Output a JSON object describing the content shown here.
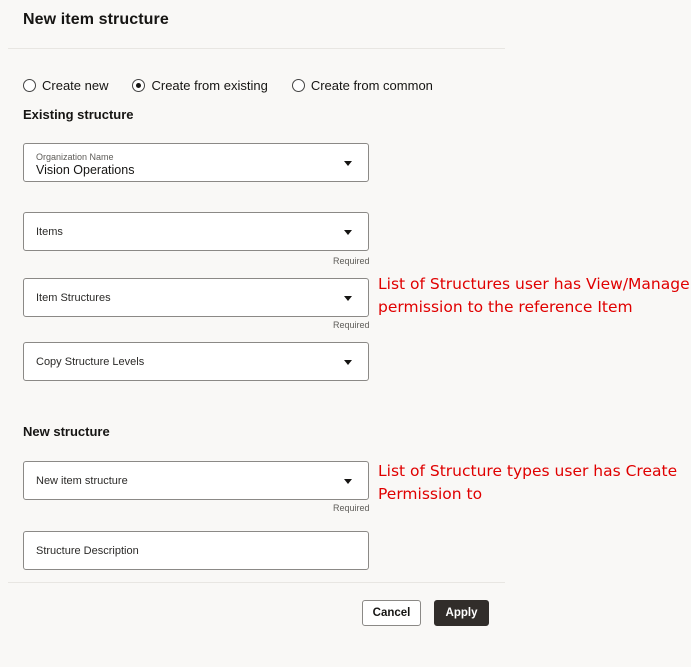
{
  "dialog": {
    "title": "New item structure"
  },
  "mode_options": [
    {
      "label": "Create new",
      "selected": false
    },
    {
      "label": "Create from existing",
      "selected": true
    },
    {
      "label": "Create from common",
      "selected": false
    }
  ],
  "existing_structure": {
    "heading": "Existing structure",
    "organization": {
      "label": "Organization Name",
      "value": "Vision Operations"
    },
    "items": {
      "placeholder": "Items",
      "required_text": "Required"
    },
    "item_structures": {
      "placeholder": "Item Structures",
      "required_text": "Required"
    },
    "copy_levels": {
      "placeholder": "Copy Structure Levels"
    }
  },
  "new_structure": {
    "heading": "New structure",
    "new_item_structure": {
      "placeholder": "New item structure",
      "required_text": "Required"
    },
    "description": {
      "placeholder": "Structure Description"
    }
  },
  "annotations": {
    "structures_line1": "List of Structures user has View/Manage",
    "structures_line2": "permission to the reference Item",
    "types_line1": "List of Structure types user has Create",
    "types_line2": "Permission to"
  },
  "buttons": {
    "cancel": "Cancel",
    "apply": "Apply"
  },
  "colors": {
    "annotation": "#e00000",
    "primary_button": "#312d2a",
    "background": "#f9f8f6"
  }
}
